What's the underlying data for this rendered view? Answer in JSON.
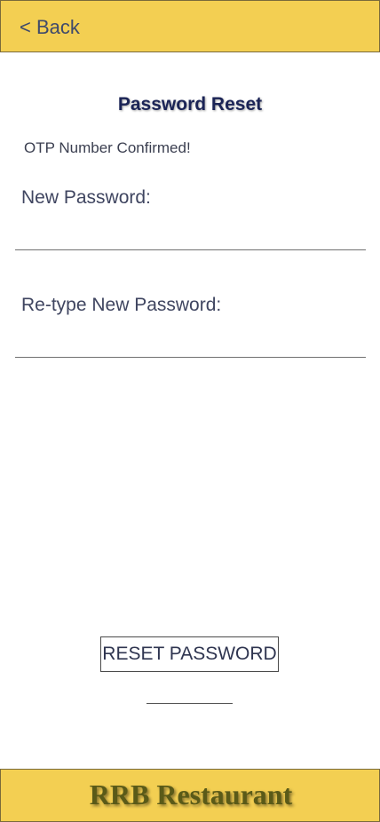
{
  "header": {
    "back_label": "< Back"
  },
  "main": {
    "title": "Password Reset",
    "status": "OTP Number Confirmed!",
    "new_password": {
      "label": "New Password:",
      "value": ""
    },
    "retype_password": {
      "label": "Re-type New Password:",
      "value": ""
    },
    "reset_button_label": "RESET PASSWORD"
  },
  "footer": {
    "brand": "RRB Restaurant"
  },
  "colors": {
    "bar_background": "#f3cf52",
    "title_color": "#1b2456",
    "brand_color": "#5a5a18"
  }
}
